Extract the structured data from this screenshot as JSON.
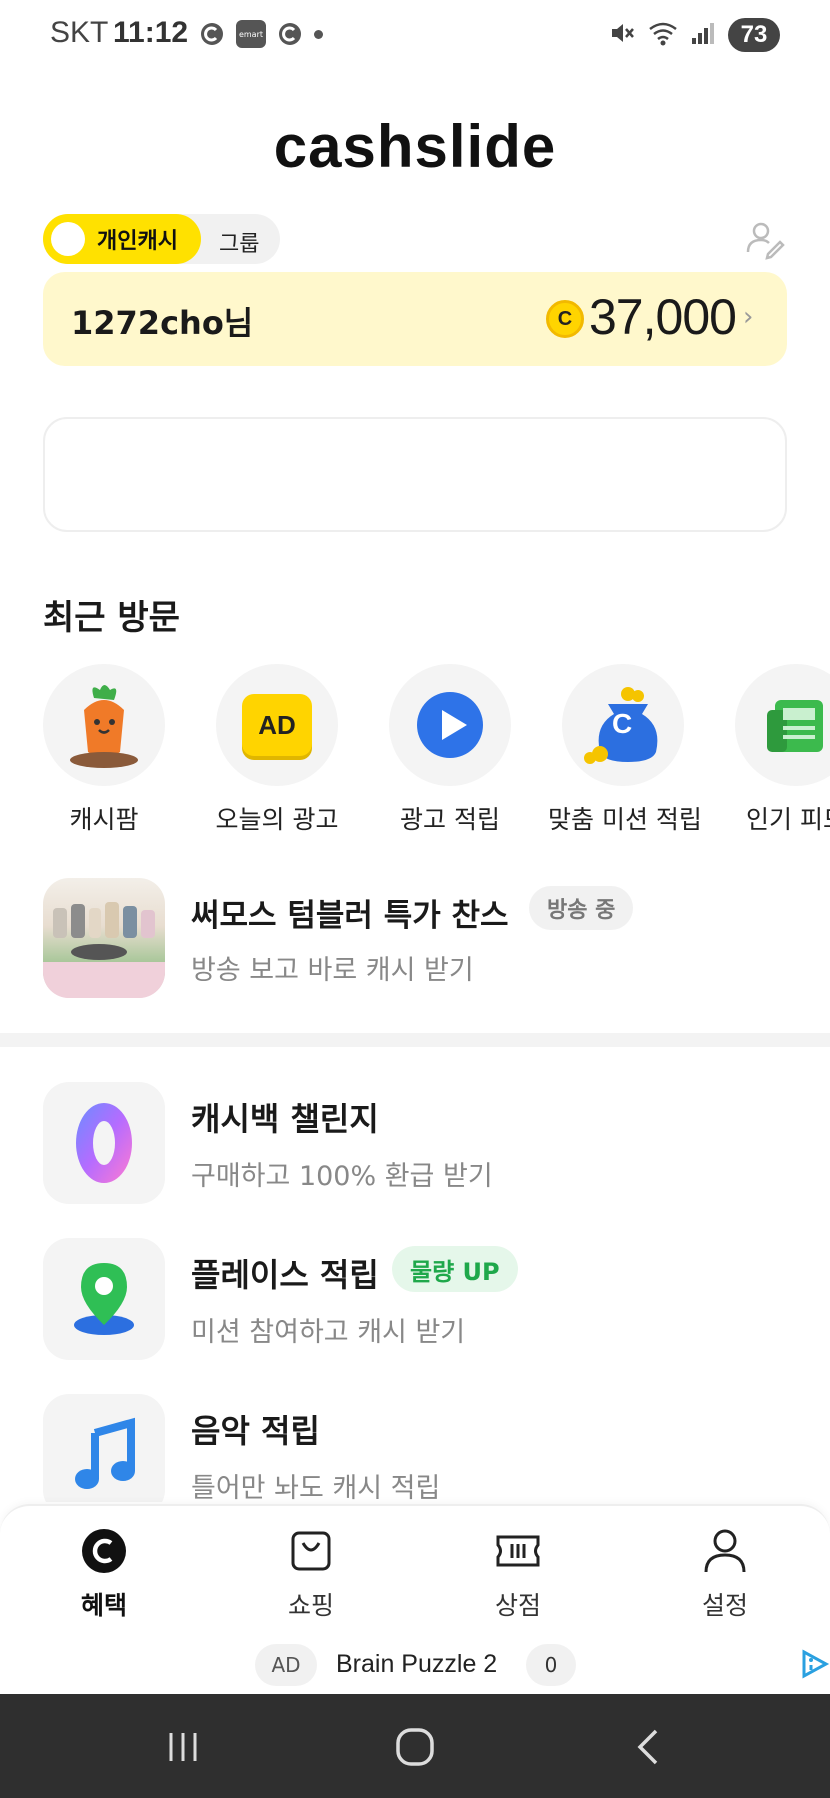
{
  "status_bar": {
    "carrier": "SKT",
    "time": "11:12",
    "app_icons": [
      "cashslide-icon",
      "emart-icon",
      "cashslide-icon"
    ],
    "emart_label": "emart",
    "battery": "73"
  },
  "header": {
    "logo": "cashslide"
  },
  "cash_toggle": {
    "active_label": "개인캐시",
    "inactive_label": "그룹"
  },
  "cash_card": {
    "user": "1272cho님",
    "coin_symbol": "C",
    "amount": "37,000",
    "chevron": "›"
  },
  "recent": {
    "title": "최근 방문",
    "items": [
      {
        "label": "캐시팜",
        "icon": "carrier-carrot-icon"
      },
      {
        "label": "오늘의 광고",
        "icon": "ad-icon",
        "icon_text": "AD"
      },
      {
        "label": "광고 적립",
        "icon": "play-icon"
      },
      {
        "label": "맞춤 미션 적립",
        "icon": "money-bag-icon",
        "icon_text": "C"
      },
      {
        "label": "인기 피드",
        "icon": "newspaper-icon"
      }
    ]
  },
  "live_promo": {
    "title": "써모스 텀블러 특가 찬스",
    "badge": "방송 중",
    "subtitle": "방송 보고 바로 캐시 받기"
  },
  "menu": [
    {
      "title": "캐시백 챌린지",
      "subtitle": "구매하고 100% 환급 받기",
      "icon": "zero-icon",
      "icon_text": "0"
    },
    {
      "title": "플레이스 적립",
      "badge": "물량 UP",
      "subtitle": "미션 참여하고 캐시 받기",
      "icon": "map-pin-icon"
    },
    {
      "title": "음악 적립",
      "subtitle": "틀어만 놔도 캐시 적립",
      "icon": "music-note-icon"
    }
  ],
  "tabbar": {
    "tabs": [
      {
        "label": "혜택",
        "icon": "cash-c-icon",
        "active": true
      },
      {
        "label": "쇼핑",
        "icon": "shopping-bag-icon"
      },
      {
        "label": "상점",
        "icon": "ticket-icon"
      },
      {
        "label": "설정",
        "icon": "person-icon"
      }
    ],
    "ad": {
      "tag": "AD",
      "title": "Brain Puzzle 2",
      "count": "0"
    }
  },
  "colors": {
    "brand_yellow": "#ffe100",
    "card_bg": "#fff8cc",
    "green_badge_text": "#1fa84b",
    "green_badge_bg": "#e5f7ea"
  }
}
